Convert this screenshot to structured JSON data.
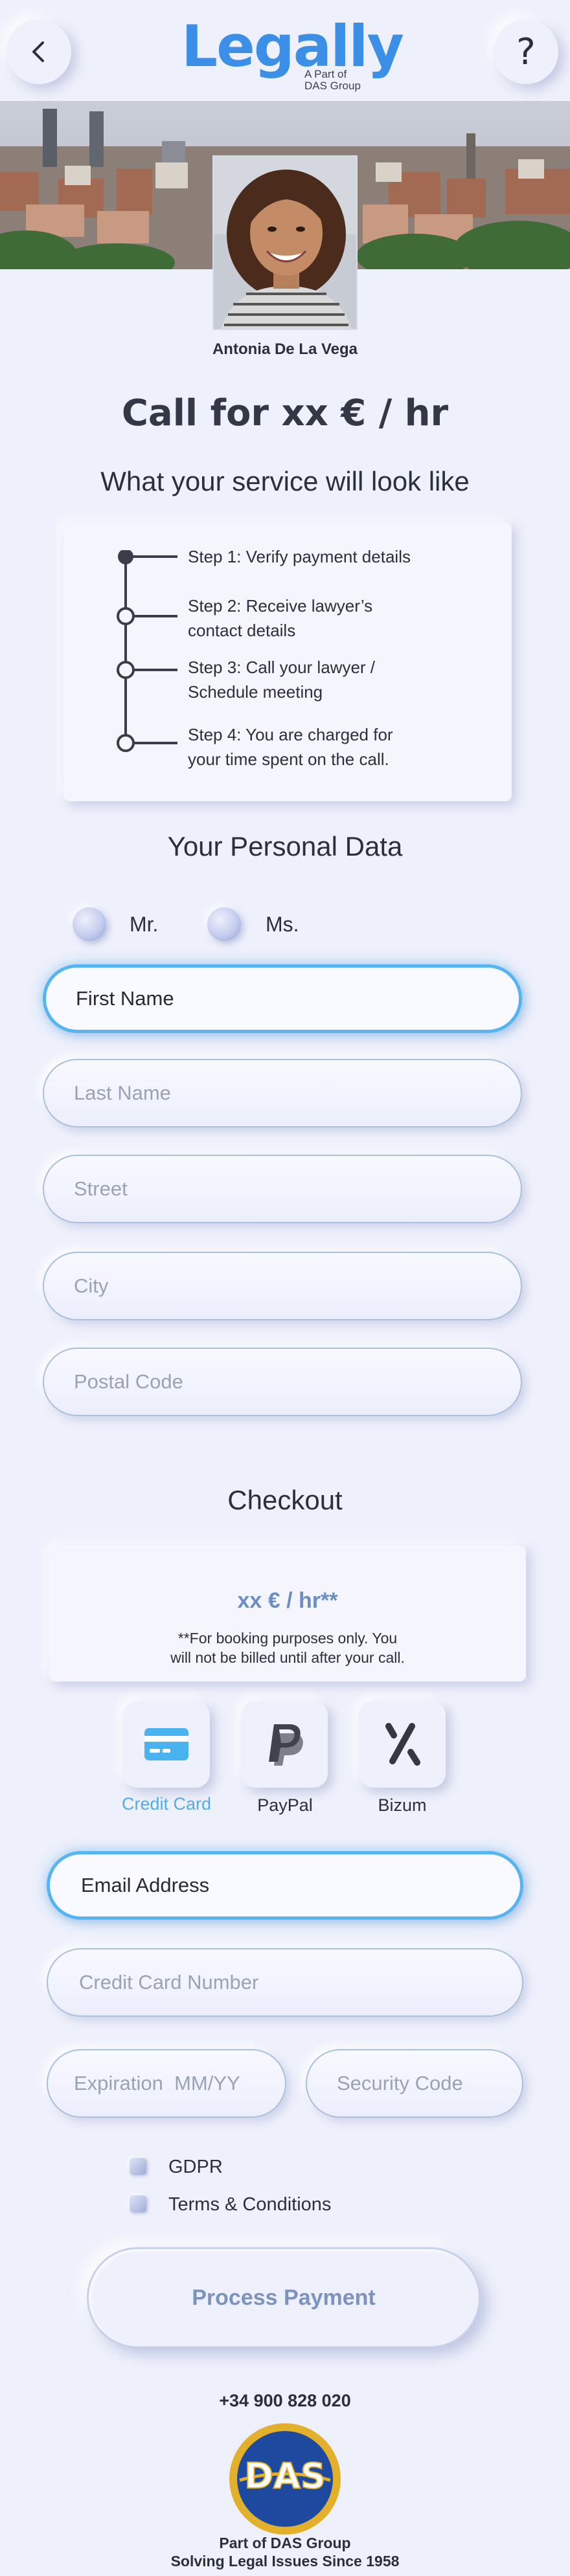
{
  "header": {
    "back_icon": "chevron-left-icon",
    "help_label": "?",
    "brand_name": "Legally",
    "brand_sub_1": "A Part of",
    "brand_sub_2": "DAS Group"
  },
  "lawyer": {
    "name": "Antonia De La Vega"
  },
  "rate": "Call for xx € / hr",
  "service": {
    "title": "What your service will look like",
    "steps": [
      {
        "line1": "Step 1: Verify payment details",
        "line2": ""
      },
      {
        "line1": "Step 2: Receive lawyer’s",
        "line2": "contact details"
      },
      {
        "line1": "Step 3: Call your lawyer /",
        "line2": "Schedule meeting"
      },
      {
        "line1": "Step 4: You are charged for",
        "line2": "your time spent on the call."
      }
    ]
  },
  "personal": {
    "title": "Your Personal Data",
    "salutations": [
      "Mr.",
      "Ms."
    ],
    "first_name": "First Name",
    "last_name_placeholder": "Last Name",
    "street_placeholder": "Street",
    "city_placeholder": "City",
    "postal_placeholder": "Postal Code"
  },
  "checkout": {
    "title": "Checkout",
    "price": "xx € / hr**",
    "note_1": "**For booking purposes only. You",
    "note_2": "will not be billed until after your call.",
    "methods": [
      {
        "label": "Credit Card",
        "icon": "credit-card-icon",
        "selected": true
      },
      {
        "label": "PayPal",
        "icon": "paypal-icon",
        "selected": false
      },
      {
        "label": "Bizum",
        "icon": "bizum-icon",
        "selected": false
      }
    ],
    "email": "Email Address",
    "card_placeholder": "Credit Card Number",
    "expiry_placeholder": "Expiration  MM/YY",
    "cvc_placeholder": "Security Code",
    "checkboxes": [
      "GDPR",
      "Terms & Conditions"
    ],
    "button": "Process Payment"
  },
  "footer": {
    "phone": "+34 900 828 020",
    "logo_text": "DAS",
    "line1": "Part of DAS Group",
    "line2": "Solving Legal Issues Since 1958"
  },
  "colors": {
    "background": "#eef0fb",
    "brand": "#3b8fe6",
    "active_border": "#56b4f0",
    "muted_button": "#7b93be",
    "das_blue": "#1d4a9e",
    "das_gold": "#e3b02c"
  }
}
